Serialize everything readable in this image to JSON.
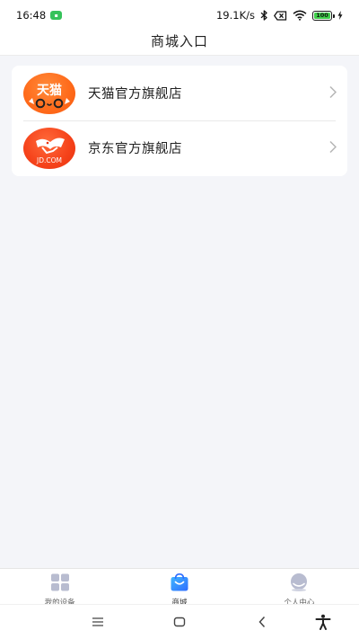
{
  "status_bar": {
    "time": "16:48",
    "network_speed": "19.1K/s",
    "battery_level": "100",
    "icons": [
      "notification-badge-icon",
      "bluetooth-icon",
      "sim-disabled-icon",
      "wifi-icon",
      "battery-icon",
      "charging-icon"
    ]
  },
  "header": {
    "title": "商城入口"
  },
  "stores": [
    {
      "name": "天猫官方旗舰店",
      "logo_text": "天猫",
      "logo_color": "#ff6a1a",
      "icon": "tmall-logo-icon"
    },
    {
      "name": "京东官方旗舰店",
      "logo_text": "JD.COM",
      "logo_color": "#f5421a",
      "icon": "jd-logo-icon"
    }
  ],
  "tabbar": {
    "tabs": [
      {
        "label": "我的设备",
        "icon": "grid-icon",
        "active": false
      },
      {
        "label": "商城",
        "icon": "shopping-bag-icon",
        "active": true
      },
      {
        "label": "个人中心",
        "icon": "profile-icon",
        "active": false
      }
    ],
    "active_color": "#2f8cff",
    "inactive_color": "#b8bcd0"
  },
  "system_nav": {
    "icons": [
      "menu-icon",
      "home-icon",
      "back-icon",
      "accessibility-icon"
    ]
  }
}
